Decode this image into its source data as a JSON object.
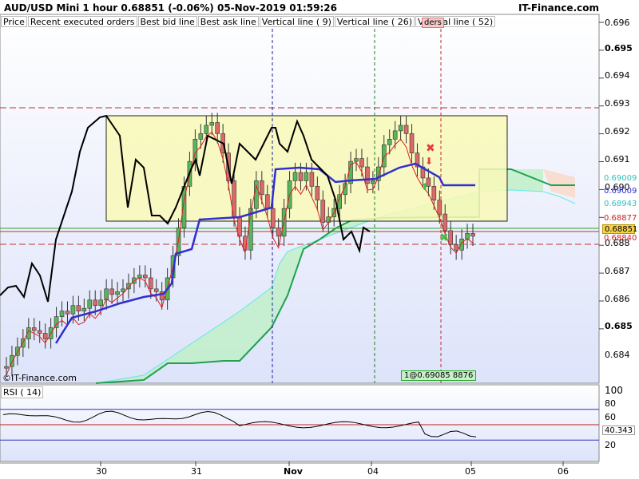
{
  "header": {
    "title": "AUD/USD Mini   1 hour   0.68851 (-0.06%)   05-Nov-2019 01:59:26",
    "brand": "IT-Finance.com"
  },
  "legend": [
    {
      "label": "Price",
      "color": "#000000"
    },
    {
      "label": "Recent executed orders",
      "color": "#d04040"
    },
    {
      "label": "Best bid line",
      "color": "#d04040"
    },
    {
      "label": "Best ask line",
      "color": "#30c030"
    },
    {
      "label": "Vertical line ( 9)",
      "color": "#d04040"
    },
    {
      "label": "Vertical line ( 26)",
      "color": "#208020"
    },
    {
      "label": "Vertical line ( 52)",
      "color": "#2020a0"
    }
  ],
  "colors": {
    "up_candle": "#5ab55a",
    "down_candle": "#d86a6a",
    "kumo_green": "#bff0c8",
    "kumo_red": "#f7dccb",
    "rectangle": "#fafab8",
    "tenkan": "#e02020",
    "kijun": "#3030d0",
    "chikou": "#000000",
    "senkou_a": "#60e8e8",
    "senkou_b": "#20a050",
    "rsi": "#000000",
    "level_lines": "#3030c0",
    "mid_line": "#c02020"
  },
  "price_tags": [
    {
      "value": "0.69009",
      "color": "#30c0c0",
      "bg": "#ffffff"
    },
    {
      "value": "0.69009",
      "color": "#3030d0",
      "bg": "#ffffff"
    },
    {
      "value": "0.68943",
      "color": "#30c0c0",
      "bg": "#ffffff"
    },
    {
      "value": "0.68877",
      "color": "#d02020",
      "bg": "#ffffff"
    },
    {
      "value": "0.68851",
      "color": "#000000",
      "bg": "#f3d24a"
    },
    {
      "value": "0.68840",
      "color": "#d02020",
      "bg": "#ffffff"
    }
  ],
  "orders": {
    "green_box": "1@0.69085",
    "green_box_tail": "8876",
    "red_box": "ders"
  },
  "copyright": "©IT-Finance.com",
  "rsi": {
    "label": "RSI ( 14)",
    "value": "40.343"
  },
  "chart_data": {
    "type": "line",
    "title": "AUD/USD Mini   1 hour",
    "y_axis": {
      "ylim": [
        0.6832,
        0.6965
      ],
      "ticks": [
        "0.684",
        "0.685",
        "0.686",
        "0.687",
        "0.688",
        "0.690",
        "0.691",
        "0.692",
        "0.693",
        "0.694",
        "0.695",
        "0.696"
      ]
    },
    "x_axis": {
      "ticks": [
        "30",
        "31",
        "Nov",
        "04",
        "05",
        "06"
      ]
    },
    "rsi_axis": {
      "ylim": [
        0,
        100
      ],
      "ticks": [
        "100",
        "80",
        "60",
        "40",
        "20"
      ]
    },
    "resistance_level": 0.69283,
    "support_level": 0.68795,
    "box": {
      "top": 0.69265,
      "bottom": 0.68865
    },
    "series": [
      {
        "name": "Price",
        "values": [
          0.6838,
          0.6842,
          0.6845,
          0.6848,
          0.6852,
          0.6851,
          0.685,
          0.6848,
          0.6852,
          0.6856,
          0.6858,
          0.6857,
          0.686,
          0.6858,
          0.6859,
          0.6862,
          0.686,
          0.6862,
          0.6866,
          0.6864,
          0.6865,
          0.6866,
          0.6868,
          0.687,
          0.6871,
          0.687,
          0.6866,
          0.6865,
          0.6862,
          0.687,
          0.6878,
          0.6888,
          0.6903,
          0.6912,
          0.692,
          0.6922,
          0.6925,
          0.6926,
          0.6922,
          0.6915,
          0.6905,
          0.6892,
          0.6885,
          0.688,
          0.6895,
          0.6905,
          0.69,
          0.6895,
          0.6888,
          0.6885,
          0.6895,
          0.6905,
          0.6908,
          0.6905,
          0.6908,
          0.6903,
          0.6898,
          0.689,
          0.6892,
          0.6895,
          0.69,
          0.6904,
          0.6912,
          0.6913,
          0.691,
          0.6904,
          0.6905,
          0.691,
          0.6918,
          0.692,
          0.6923,
          0.6925,
          0.6922,
          0.6915,
          0.691,
          0.6906,
          0.6903,
          0.6898,
          0.6893,
          0.6887,
          0.6882,
          0.688,
          0.6884,
          0.6886,
          0.6885
        ]
      }
    ]
  }
}
